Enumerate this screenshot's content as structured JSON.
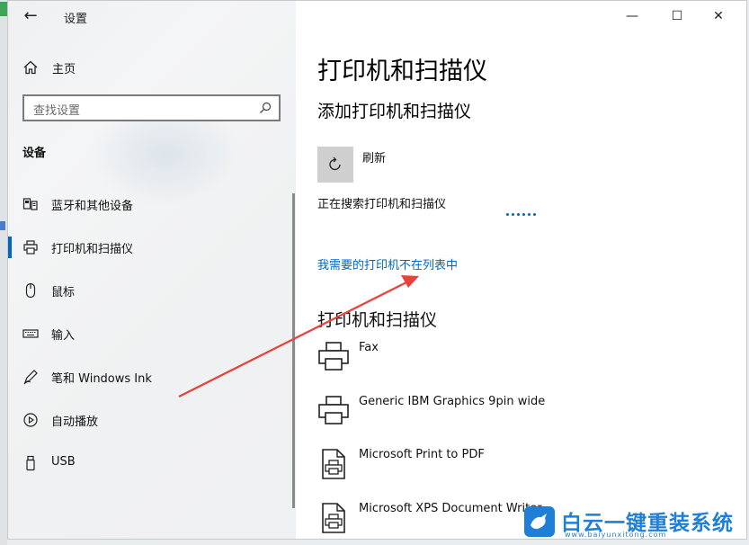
{
  "window": {
    "app_title": "设置",
    "back_icon": "back-arrow-icon",
    "caption": {
      "minimize": "—",
      "maximize": "☐",
      "close": "✕"
    }
  },
  "nav": {
    "home_label": "主页",
    "search_placeholder": "查找设置",
    "section_title": "设备",
    "items": [
      {
        "label": "蓝牙和其他设备",
        "icon": "bluetooth-devices-icon",
        "selected": false
      },
      {
        "label": "打印机和扫描仪",
        "icon": "printer-icon",
        "selected": true
      },
      {
        "label": "鼠标",
        "icon": "mouse-icon",
        "selected": false
      },
      {
        "label": "输入",
        "icon": "keyboard-icon",
        "selected": false
      },
      {
        "label": "笔和 Windows Ink",
        "icon": "pen-icon",
        "selected": false
      },
      {
        "label": "自动播放",
        "icon": "autoplay-icon",
        "selected": false
      },
      {
        "label": "USB",
        "icon": "usb-icon",
        "selected": false
      }
    ]
  },
  "content": {
    "page_title": "打印机和扫描仪",
    "add_title": "添加打印机和扫描仪",
    "refresh_label": "刷新",
    "searching_text": "正在搜索打印机和扫描仪",
    "missing_link": "我需要的打印机不在列表中",
    "list_title": "打印机和扫描仪",
    "printers": [
      {
        "name": "Fax",
        "icon": "printer-icon"
      },
      {
        "name": "Generic IBM Graphics 9pin wide",
        "icon": "printer-icon"
      },
      {
        "name": "Microsoft Print to PDF",
        "icon": "document-printer-icon"
      },
      {
        "name": "Microsoft XPS Document Writer",
        "icon": "document-printer-icon"
      }
    ]
  },
  "watermark": {
    "brand": "白云一键重装系统",
    "url": "www.baiyunxitong.com"
  },
  "colors": {
    "accent": "#0067c0",
    "arrow": "#e8403a",
    "watermark": "#1f7fd6"
  }
}
